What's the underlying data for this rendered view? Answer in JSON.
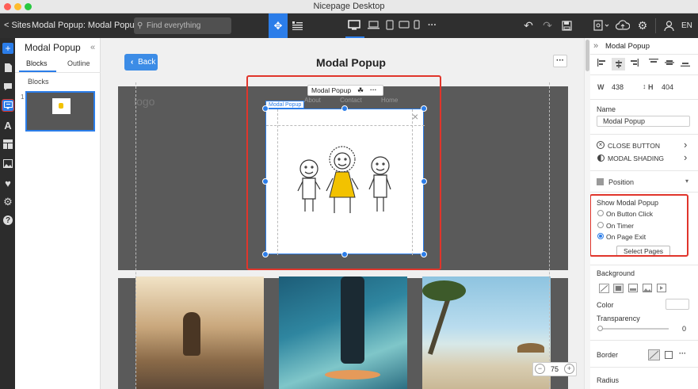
{
  "window": {
    "title": "Nicepage Desktop"
  },
  "toolbar": {
    "sites_label": "< Sites",
    "doc_title": "Modal Popup: Modal Popup",
    "search_placeholder": "Find everything",
    "more_label": "···",
    "lang": "EN"
  },
  "left_panel": {
    "title": "Modal Popup",
    "tabs": [
      "Blocks",
      "Outline"
    ],
    "section_label": "Blocks",
    "block_number": "1"
  },
  "canvas": {
    "back_label": "Back",
    "page_title": "Modal Popup",
    "more_label": "···",
    "site_logo": "logo",
    "site_nav": [
      "About",
      "Contact",
      "Home"
    ],
    "popup_badge": "Modal Popup",
    "popup_toolbar_label": "Modal Popup",
    "popup_toolbar_more": "···",
    "zoom": "75",
    "photos": [
      "woman-on-beach-photo",
      "surfer-photo",
      "palm-beach-photo"
    ]
  },
  "right_panel": {
    "header": "Modal Popup",
    "width_label": "W",
    "width_value": "438",
    "height_label": "H",
    "height_value": "404",
    "name_label": "Name",
    "name_value": "Modal Popup",
    "close_button": "CLOSE BUTTON",
    "modal_shading": "MODAL SHADING",
    "position": "Position",
    "show_label": "Show Modal Popup",
    "options": [
      {
        "label": "On Button Click",
        "selected": false
      },
      {
        "label": "On Timer",
        "selected": false
      },
      {
        "label": "On Page Exit",
        "selected": true
      }
    ],
    "select_pages": "Select Pages",
    "background_label": "Background",
    "color_label": "Color",
    "transparency_label": "Transparency",
    "transparency_value": "0",
    "border_label": "Border",
    "border_more": "···",
    "radius_label": "Radius"
  },
  "colors": {
    "accent": "#2b7de9",
    "highlight": "#e0352b",
    "toolbar_bg": "#2f2f2f",
    "canvas_page_bg": "#5a5a5a"
  }
}
